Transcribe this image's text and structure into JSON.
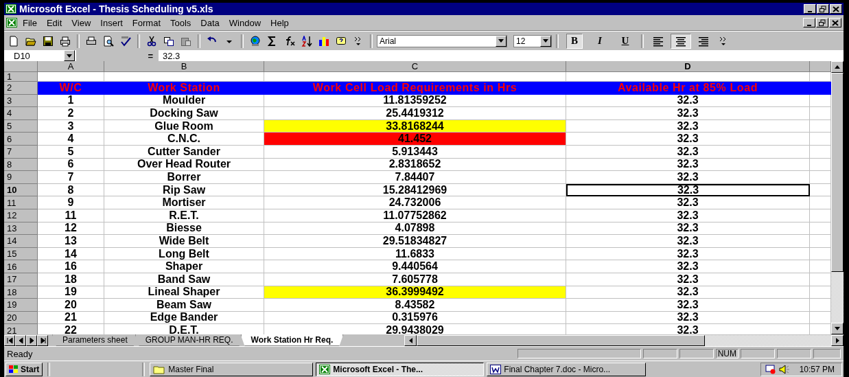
{
  "window": {
    "title": "Microsoft Excel - Thesis Scheduling v5.xls"
  },
  "menu": [
    "File",
    "Edit",
    "View",
    "Insert",
    "Format",
    "Tools",
    "Data",
    "Window",
    "Help"
  ],
  "toolbar": {
    "font": "Arial",
    "size": "12"
  },
  "format_buttons": [
    {
      "label": "B",
      "selected": true
    },
    {
      "label": "I",
      "selected": false
    },
    {
      "label": "U",
      "selected": false
    }
  ],
  "align_buttons": [
    {
      "kind": "left",
      "selected": false
    },
    {
      "kind": "center",
      "selected": true
    },
    {
      "kind": "right",
      "selected": false
    }
  ],
  "formula_bar": {
    "name_box": "D10",
    "sign": "=",
    "value": "32.3"
  },
  "columns": [
    "A",
    "B",
    "C",
    "D"
  ],
  "rows": [
    {
      "number": "1",
      "selected": false,
      "cells": []
    },
    {
      "number": "2",
      "selected": false,
      "kind": "header",
      "cells": [
        {
          "text": "W/C",
          "selected": false
        },
        {
          "text": "Work Station",
          "selected": false
        },
        {
          "text": "Work Cell Load Requirements in Hrs",
          "selected": false
        },
        {
          "text": "Available Hr at 85% Load",
          "selected": false
        }
      ]
    },
    {
      "number": "3",
      "selected": false,
      "cells": [
        {
          "text": "1",
          "selected": false
        },
        {
          "text": "Moulder",
          "selected": false
        },
        {
          "text": "11.81359252",
          "selected": false
        },
        {
          "text": "32.3",
          "selected": false
        }
      ]
    },
    {
      "number": "4",
      "selected": false,
      "cells": [
        {
          "text": "2",
          "selected": false
        },
        {
          "text": "Docking Saw",
          "selected": false
        },
        {
          "text": "25.4419312",
          "selected": false
        },
        {
          "text": "32.3",
          "selected": false
        }
      ]
    },
    {
      "number": "5",
      "selected": false,
      "cells": [
        {
          "text": "3",
          "selected": false
        },
        {
          "text": "Glue Room",
          "selected": false
        },
        {
          "text": "33.8168244",
          "selected": false,
          "color": "#ffff00"
        },
        {
          "text": "32.3",
          "selected": false
        }
      ]
    },
    {
      "number": "6",
      "selected": false,
      "cells": [
        {
          "text": "4",
          "selected": false
        },
        {
          "text": "C.N.C.",
          "selected": false
        },
        {
          "text": "41.452",
          "selected": false,
          "color": "#ff0000"
        },
        {
          "text": "32.3",
          "selected": false
        }
      ]
    },
    {
      "number": "7",
      "selected": false,
      "cells": [
        {
          "text": "5",
          "selected": false
        },
        {
          "text": "Cutter Sander",
          "selected": false
        },
        {
          "text": "5.913443",
          "selected": false
        },
        {
          "text": "32.3",
          "selected": false
        }
      ]
    },
    {
      "number": "8",
      "selected": false,
      "cells": [
        {
          "text": "6",
          "selected": false
        },
        {
          "text": "Over Head Router",
          "selected": false
        },
        {
          "text": "2.8318652",
          "selected": false
        },
        {
          "text": "32.3",
          "selected": false
        }
      ]
    },
    {
      "number": "9",
      "selected": false,
      "cells": [
        {
          "text": "7",
          "selected": false
        },
        {
          "text": "Borrer",
          "selected": false
        },
        {
          "text": "7.84407",
          "selected": false
        },
        {
          "text": "32.3",
          "selected": false
        }
      ]
    },
    {
      "number": "10",
      "selected": true,
      "cells": [
        {
          "text": "8",
          "selected": false
        },
        {
          "text": "Rip Saw",
          "selected": false
        },
        {
          "text": "15.28412969",
          "selected": false
        },
        {
          "text": "32.3",
          "selected": true
        }
      ]
    },
    {
      "number": "11",
      "selected": false,
      "cells": [
        {
          "text": "9",
          "selected": false
        },
        {
          "text": "Mortiser",
          "selected": false
        },
        {
          "text": "24.732006",
          "selected": false
        },
        {
          "text": "32.3",
          "selected": false
        }
      ]
    },
    {
      "number": "12",
      "selected": false,
      "cells": [
        {
          "text": "11",
          "selected": false
        },
        {
          "text": "R.E.T.",
          "selected": false
        },
        {
          "text": "11.07752862",
          "selected": false
        },
        {
          "text": "32.3",
          "selected": false
        }
      ]
    },
    {
      "number": "13",
      "selected": false,
      "cells": [
        {
          "text": "12",
          "selected": false
        },
        {
          "text": "Biesse",
          "selected": false
        },
        {
          "text": "4.07898",
          "selected": false
        },
        {
          "text": "32.3",
          "selected": false
        }
      ]
    },
    {
      "number": "14",
      "selected": false,
      "cells": [
        {
          "text": "13",
          "selected": false
        },
        {
          "text": "Wide Belt",
          "selected": false
        },
        {
          "text": "29.51834827",
          "selected": false
        },
        {
          "text": "32.3",
          "selected": false
        }
      ]
    },
    {
      "number": "15",
      "selected": false,
      "cells": [
        {
          "text": "14",
          "selected": false
        },
        {
          "text": "Long Belt",
          "selected": false
        },
        {
          "text": "11.6833",
          "selected": false
        },
        {
          "text": "32.3",
          "selected": false
        }
      ]
    },
    {
      "number": "16",
      "selected": false,
      "cells": [
        {
          "text": "16",
          "selected": false
        },
        {
          "text": "Shaper",
          "selected": false
        },
        {
          "text": "9.440564",
          "selected": false
        },
        {
          "text": "32.3",
          "selected": false
        }
      ]
    },
    {
      "number": "17",
      "selected": false,
      "cells": [
        {
          "text": "18",
          "selected": false
        },
        {
          "text": "Band Saw",
          "selected": false
        },
        {
          "text": "7.605778",
          "selected": false
        },
        {
          "text": "32.3",
          "selected": false
        }
      ]
    },
    {
      "number": "18",
      "selected": false,
      "cells": [
        {
          "text": "19",
          "selected": false
        },
        {
          "text": "Lineal Shaper",
          "selected": false
        },
        {
          "text": "36.3999492",
          "selected": false,
          "color": "#ffff00"
        },
        {
          "text": "32.3",
          "selected": false
        }
      ]
    },
    {
      "number": "19",
      "selected": false,
      "cells": [
        {
          "text": "20",
          "selected": false
        },
        {
          "text": "Beam Saw",
          "selected": false
        },
        {
          "text": "8.43582",
          "selected": false
        },
        {
          "text": "32.3",
          "selected": false
        }
      ]
    },
    {
      "number": "20",
      "selected": false,
      "cells": [
        {
          "text": "21",
          "selected": false
        },
        {
          "text": "Edge Bander",
          "selected": false
        },
        {
          "text": "0.315976",
          "selected": false
        },
        {
          "text": "32.3",
          "selected": false
        }
      ]
    },
    {
      "number": "21",
      "selected": false,
      "cells": [
        {
          "text": "22",
          "selected": false
        },
        {
          "text": "D.E.T.",
          "selected": false
        },
        {
          "text": "29.9438029",
          "selected": false
        },
        {
          "text": "32.3",
          "selected": false
        }
      ]
    }
  ],
  "sheet_tabs": [
    {
      "label": "Parameters sheet",
      "selected": false
    },
    {
      "label": "GROUP MAN-HR REQ.",
      "selected": false
    },
    {
      "label": "Work Station Hr Req.",
      "selected": true
    }
  ],
  "status_bar": {
    "text": "Ready",
    "indicator": "NUM"
  },
  "taskbar": {
    "start": "Start",
    "items": [
      {
        "kind": "folder",
        "label": "Master Final",
        "selected": false
      },
      {
        "kind": "excel",
        "label": "Microsoft Excel - The...",
        "selected": true
      },
      {
        "kind": "word",
        "label": "Final Chapter 7.doc - Micro...",
        "selected": false
      }
    ],
    "clock": "10:57 PM"
  }
}
